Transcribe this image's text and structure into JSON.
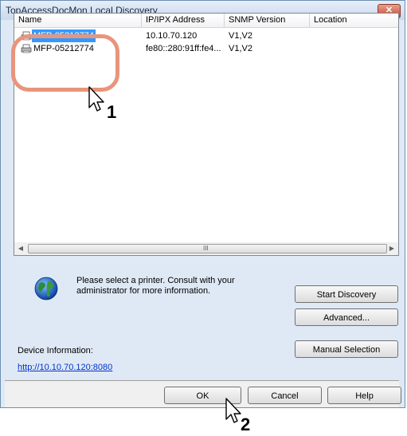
{
  "window": {
    "title": "TopAccessDocMon Local Discovery",
    "close_glyph": "✕"
  },
  "list": {
    "columns": [
      {
        "label": "Name"
      },
      {
        "label": "IP/IPX Address"
      },
      {
        "label": "SNMP Version"
      },
      {
        "label": "Location"
      }
    ],
    "rows": [
      {
        "name": "MFP-05212774",
        "address": "10.10.70.120",
        "snmp": "V1,V2",
        "location": ""
      },
      {
        "name": "MFP-05212774",
        "address": "fe80::280:91ff:fe4...",
        "snmp": "V1,V2",
        "location": ""
      }
    ],
    "scroll_grip": "III"
  },
  "info": {
    "message": "Please select a printer. Consult with your administrator for more information."
  },
  "buttons": {
    "start_discovery": "Start Discovery",
    "advanced": "Advanced...",
    "manual_selection": "Manual Selection",
    "ok": "OK",
    "cancel": "Cancel",
    "help": "Help"
  },
  "device": {
    "label": "Device Information:",
    "url": "http://10.10.70.120:8080"
  },
  "callouts": {
    "step1": "1",
    "step2": "2"
  },
  "colors": {
    "selection": "#3399ff",
    "highlight": "#e8957c",
    "link": "#0033cc"
  }
}
